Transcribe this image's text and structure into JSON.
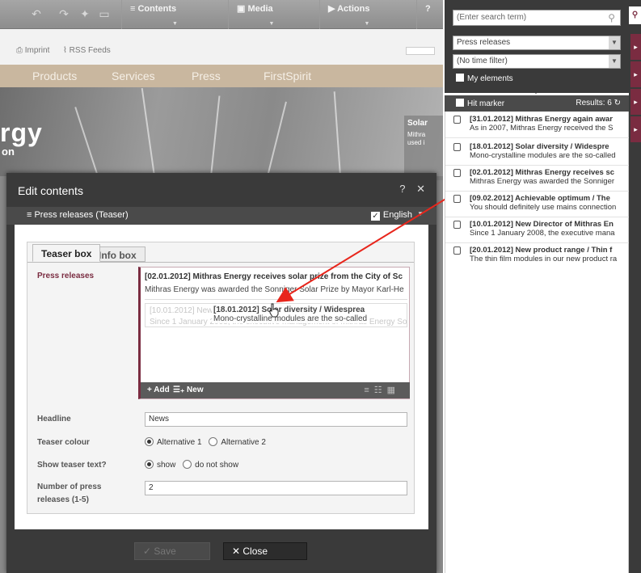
{
  "toolbar": {
    "contents_label": "≡  Contents",
    "media_label": "Media",
    "actions_label": "Actions",
    "help_label": "?"
  },
  "site": {
    "imprint": "Imprint",
    "rss": "RSS Feeds",
    "nav": [
      "Products",
      "Services",
      "Press",
      "FirstSpirit"
    ],
    "hero_title": "rgy",
    "hero_subtitle": "on",
    "hero_side_title": "Solar",
    "hero_side_text1": "Mithra",
    "hero_side_text2": "used i"
  },
  "dialog": {
    "title": "Edit contents",
    "help": "?",
    "close": "✕",
    "subtitle": "≡  Press releases (Teaser)",
    "language": "English",
    "tabs": [
      "Teaser box",
      "Info box"
    ],
    "press_releases_label": "Press releases",
    "press_items": [
      {
        "line1": "[02.01.2012] Mithras Energy receives solar prize from the City of Sc",
        "line2": "Mithras Energy was awarded the Sonniger Solar Prize by Mayor Karl-He"
      },
      {
        "line1": "[10.01.2012] New Director of Mithras Energy reinforc",
        "line2": "Since 1 January 2008, the executive management of Mithras Energy So"
      }
    ],
    "drag_item": {
      "line1": "[18.01.2012] Solar diversity / Widesprea",
      "line2": "Mono-crystalline modules are the so-called"
    },
    "add_label": "Add",
    "new_label": "New",
    "headline_label": "Headline",
    "headline_value": "News",
    "teaser_colour_label": "Teaser colour",
    "teaser_colour_opt1": "Alternative 1",
    "teaser_colour_opt2": "Alternative 2",
    "show_teaser_label": "Show teaser text?",
    "show_opt1": "show",
    "show_opt2": "do not show",
    "number_label_line1": "Number of press",
    "number_label_line2": "releases (1-5)",
    "number_value": "2",
    "save_label": "Save",
    "close_label": "Close"
  },
  "search": {
    "placeholder": "(Enter search term)",
    "type_filter": "Press releases",
    "time_filter": "(No time filter)",
    "my_elements": "My elements",
    "hit_marker": "Hit marker",
    "results_label": "Results: 6",
    "results": [
      {
        "title": "[31.01.2012] Mithras Energy again awar",
        "text": "As in 2007, Mithras Energy received the S"
      },
      {
        "title": "[18.01.2012] Solar diversity / Widespre",
        "text": "Mono-crystalline modules are the so-called"
      },
      {
        "title": "[02.01.2012] Mithras Energy receives sc",
        "text": "Mithras Energy was awarded the Sonniger"
      },
      {
        "title": "[09.02.2012] Achievable optimum / The",
        "text": "You should definitely use mains connection"
      },
      {
        "title": "[10.01.2012] New Director of Mithras En",
        "text": "Since 1 January 2008, the executive mana"
      },
      {
        "title": "[20.01.2012] New product range / Thin f",
        "text": "The thin film modules in our new product ra"
      }
    ]
  },
  "colors": {
    "accent": "#7a2c41",
    "dialog_bg": "#3a3a3a",
    "arrow": "#e8261c"
  }
}
